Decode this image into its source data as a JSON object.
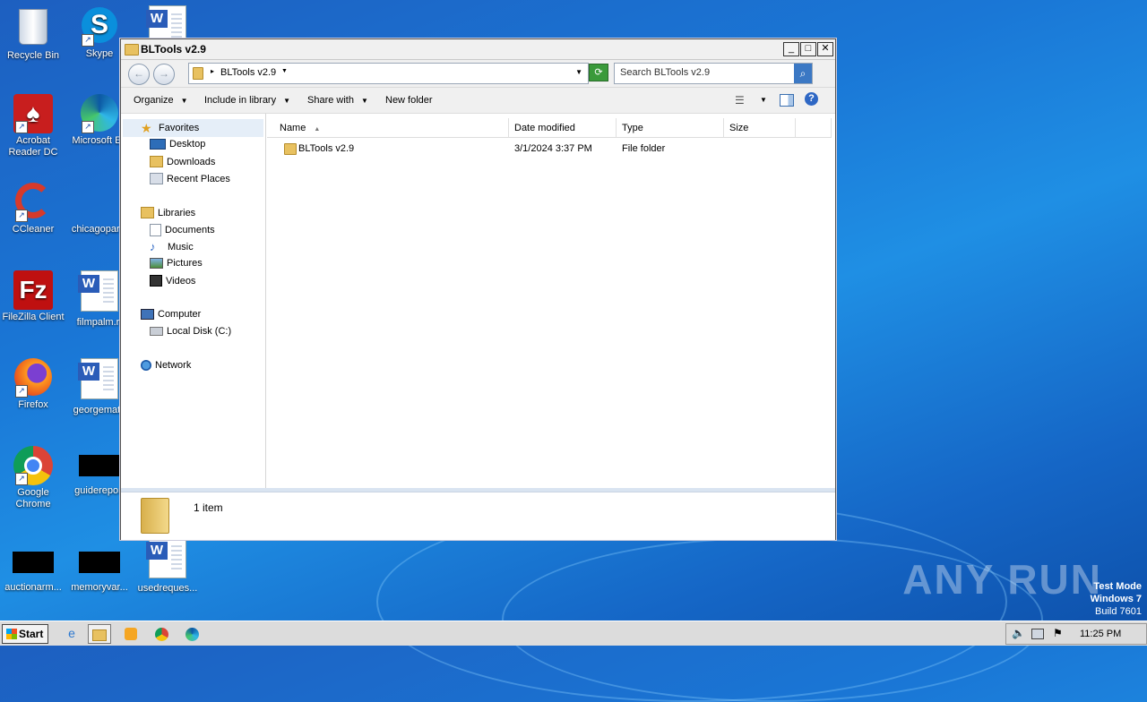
{
  "desktop": {
    "icons": [
      {
        "label": "Recycle Bin"
      },
      {
        "label": "Skype"
      },
      {
        "label": "Acrobat Reader DC"
      },
      {
        "label": "Microsoft Ed"
      },
      {
        "label": "CCleaner"
      },
      {
        "label": "chicagopar..."
      },
      {
        "label": "FileZilla Client"
      },
      {
        "label": "filmpalm.rt"
      },
      {
        "label": "Firefox"
      },
      {
        "label": "georgemato"
      },
      {
        "label": "Google Chrome"
      },
      {
        "label": "guidereport"
      },
      {
        "label": "auctionarm..."
      },
      {
        "label": "memoryvar..."
      },
      {
        "label": "usedreques..."
      }
    ]
  },
  "window": {
    "title": "BLTools v2.9",
    "address_crumb": "BLTools v2.9",
    "search_placeholder": "Search BLTools v2.9",
    "toolbar": {
      "organize": "Organize",
      "include_in_library": "Include in library",
      "share_with": "Share with",
      "new_folder": "New folder"
    },
    "nav": {
      "favorites": "Favorites",
      "desktop": "Desktop",
      "downloads": "Downloads",
      "recent_places": "Recent Places",
      "libraries": "Libraries",
      "documents": "Documents",
      "music": "Music",
      "pictures": "Pictures",
      "videos": "Videos",
      "computer": "Computer",
      "local_disk": "Local Disk (C:)",
      "network": "Network"
    },
    "columns": {
      "name": "Name",
      "date_modified": "Date modified",
      "type": "Type",
      "size": "Size"
    },
    "files": [
      {
        "name": "BLTools v2.9",
        "date": "3/1/2024 3:37 PM",
        "type": "File folder",
        "size": ""
      }
    ],
    "status": "1 item"
  },
  "taskbar": {
    "start": "Start",
    "clock": "11:25 PM"
  },
  "watermark": "ANY RUN",
  "test_mode": {
    "line1": "Test Mode",
    "line2": "Windows 7",
    "line3": "Build 7601"
  }
}
